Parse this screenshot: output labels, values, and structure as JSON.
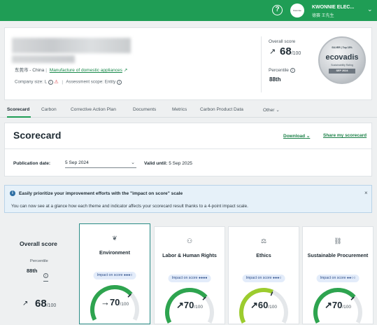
{
  "topbar": {
    "help_icon": "help-circle-icon",
    "company_logo_text": "Kwonnie",
    "company_name": "KWONNIE ELEC...",
    "company_sub": "德赛 王先生",
    "chevron_icon": "chevron-down-icon"
  },
  "summary": {
    "location": "东莞市 - China",
    "industry": "Manufacture of domestic appliances",
    "company_size": "Company size: L",
    "assessment_scope": "Assessment scope: Entity",
    "overall_label": "Overall score",
    "overall_arrow": "↗",
    "overall_score": "68",
    "overall_max": "/100",
    "percentile_label": "Percentile",
    "percentile_value": "88th",
    "medal": {
      "top": "SILVER | Top 15%",
      "brand": "ecovadis",
      "sub": "Sustainability Rating",
      "date": "SEP 2024"
    }
  },
  "tabs": [
    "Scorecard",
    "Carbon",
    "Corrective Action Plan",
    "Documents",
    "Metrics",
    "Carbon Product Data",
    "Other"
  ],
  "scorecard": {
    "title": "Scorecard",
    "download": "Download",
    "share": "Share my scorecard",
    "publication_label": "Publication date:",
    "publication_value": "5 Sep 2024",
    "valid_label": "Valid until:",
    "valid_value": "5 Sep 2025"
  },
  "banner": {
    "title": "Easily prioritize your improvement efforts with the \"impact on score\" scale",
    "text": "You can now see at a glance how each theme and indicator affects your scorecard result thanks to a 4-point impact scale.",
    "close": "×"
  },
  "overall": {
    "title": "Overall score",
    "percentile_label": "Percentile",
    "percentile_value": "88th",
    "arrow": "↗",
    "score": "68",
    "max": "/100"
  },
  "themes": [
    {
      "name": "Environment",
      "icon": "leaf-icon",
      "impact_label": "Impact on score",
      "impact_dots": "●●●○",
      "arrow": "→",
      "score": "70",
      "max": "/100",
      "fraction": 0.7,
      "color": "#2ea44f"
    },
    {
      "name": "Labor & Human Rights",
      "icon": "people-icon",
      "impact_label": "Impact on score",
      "impact_dots": "●●●●",
      "arrow": "↗",
      "score": "70",
      "max": "/100",
      "fraction": 0.7,
      "color": "#2ea44f"
    },
    {
      "name": "Ethics",
      "icon": "scales-icon",
      "impact_label": "Impact on score",
      "impact_dots": "●●●○",
      "arrow": "↗",
      "score": "60",
      "max": "/100",
      "fraction": 0.6,
      "color": "#9ccc2e"
    },
    {
      "name": "Sustainable Procurement",
      "icon": "chain-icon",
      "impact_label": "Impact on score",
      "impact_dots": "●●○○",
      "arrow": "↗",
      "score": "70",
      "max": "/100",
      "fraction": 0.7,
      "color": "#2ea44f"
    }
  ],
  "colors": {
    "brand": "#1f9d55",
    "accent_link": "#1a7f46",
    "banner_bg": "#e6f1f9"
  }
}
